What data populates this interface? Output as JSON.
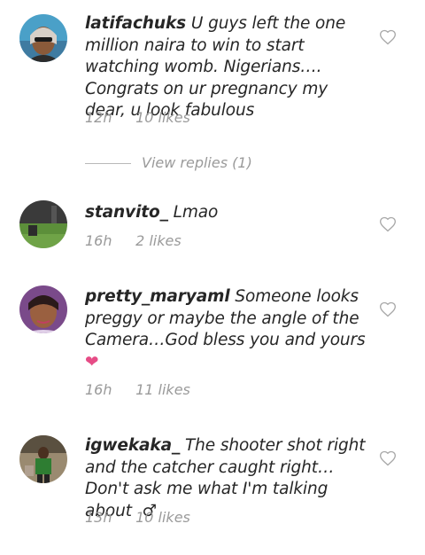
{
  "comments": [
    {
      "username": "latifachuks",
      "text": "U guys left the one million naira to win to start watching womb. Nigerians…. Congrats on ur pregnancy my dear, u look fabulous",
      "time": "12h",
      "likes": "10 likes",
      "replies": "View replies (1)"
    },
    {
      "username": "stanvito_",
      "text": "Lmao",
      "time": "16h",
      "likes": "2 likes"
    },
    {
      "username": "pretty_maryaml",
      "text": "Someone looks preggy or maybe the angle of the Camera…God bless you and yours",
      "emoji": "❤",
      "time": "16h",
      "likes": "11 likes"
    },
    {
      "username": "igwekaka_",
      "text": "The shooter shot right and the catcher caught right… Don't ask me what I'm talking about",
      "emoji": "♂",
      "time": "13h",
      "likes": "10 likes"
    }
  ],
  "icons": {
    "like": "heart-outline-icon"
  },
  "colors": {
    "text": "#262626",
    "meta": "#9a9a9a",
    "heart_outline": "#a8a8a8",
    "emoji_heart": "#e64c86"
  }
}
